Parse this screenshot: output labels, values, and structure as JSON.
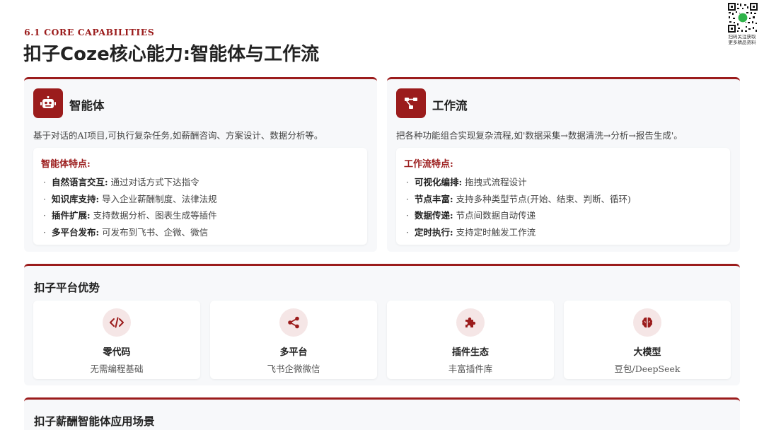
{
  "header": {
    "subtitle": "6.1 CORE CAPABILITIES",
    "title": "扣子Coze核心能力:智能体与工作流"
  },
  "qr": {
    "caption_line1": "扫码关注获取",
    "caption_line2": "更多精品资料"
  },
  "agent_card": {
    "icon": "robot-icon",
    "title": "智能体",
    "description": "基于对话的AI项目,可执行复杂任务,如薪酬咨询、方案设计、数据分析等。",
    "features_title": "智能体特点:",
    "features": [
      {
        "key": "自然语言交互:",
        "value": "通过对话方式下达指令"
      },
      {
        "key": "知识库支持:",
        "value": "导入企业薪酬制度、法律法规"
      },
      {
        "key": "插件扩展:",
        "value": "支持数据分析、图表生成等插件"
      },
      {
        "key": "多平台发布:",
        "value": "可发布到飞书、企微、微信"
      }
    ]
  },
  "workflow_card": {
    "icon": "workflow-icon",
    "title": "工作流",
    "description": "把各种功能组合实现复杂流程,如'数据采集→数据清洗→分析→报告生成'。",
    "features_title": "工作流特点:",
    "features": [
      {
        "key": "可视化编排:",
        "value": "拖拽式流程设计"
      },
      {
        "key": "节点丰富:",
        "value": "支持多种类型节点(开始、结束、判断、循环)"
      },
      {
        "key": "数据传递:",
        "value": "节点间数据自动传递"
      },
      {
        "key": "定时执行:",
        "value": "支持定时触发工作流"
      }
    ]
  },
  "advantages": {
    "title": "扣子平台优势",
    "items": [
      {
        "icon": "code-icon",
        "name": "零代码",
        "desc": "无需编程基础"
      },
      {
        "icon": "share-icon",
        "name": "多平台",
        "desc": "飞书企微微信"
      },
      {
        "icon": "puzzle-icon",
        "name": "插件生态",
        "desc": "丰富插件库"
      },
      {
        "icon": "brain-icon",
        "name": "大模型",
        "desc": "豆包/DeepSeek"
      }
    ]
  },
  "scenarios": {
    "title": "扣子薪酬智能体应用场景"
  },
  "colors": {
    "accent": "#9b1c1c",
    "card_bg": "#f7f8fa",
    "icon_circle_bg": "#f5e6e6"
  }
}
